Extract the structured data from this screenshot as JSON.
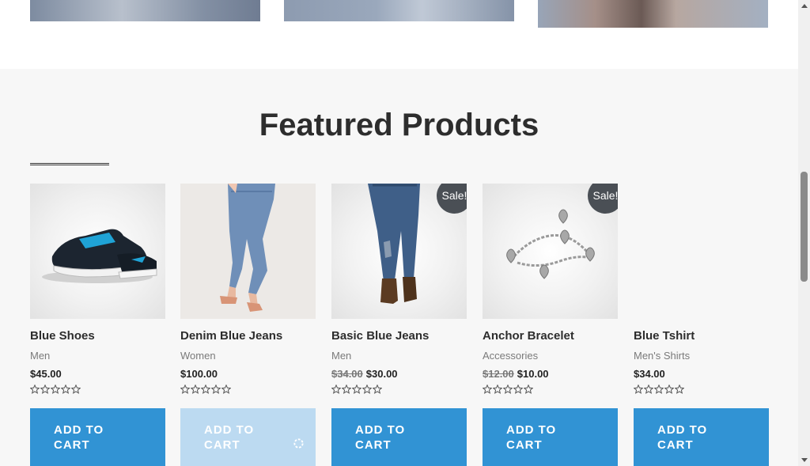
{
  "section_title": "Featured Products",
  "products": [
    {
      "name": "Blue Shoes",
      "category": "Men",
      "price": "$45.00",
      "old_price": "",
      "sale": "",
      "rating": 0,
      "button": "ADD TO CART",
      "image": "shoes-image"
    },
    {
      "name": "Denim Blue Jeans",
      "category": "Women",
      "price": "$100.00",
      "old_price": "",
      "sale": "",
      "rating": 0,
      "button": "ADD TO CART",
      "image": "jeans-image"
    },
    {
      "name": "Basic Blue Jeans",
      "category": "Men",
      "price": "$30.00",
      "old_price": "$34.00",
      "sale": "Sale!",
      "rating": 0,
      "button": "ADD TO CART",
      "image": "jeans-boots-image"
    },
    {
      "name": "Anchor Bracelet",
      "category": "Accessories",
      "price": "$10.00",
      "old_price": "$12.00",
      "sale": "Sale!",
      "rating": 0,
      "button": "ADD TO CART",
      "image": "bracelet-image"
    },
    {
      "name": "Blue Tshirt",
      "category": "Men's Shirts",
      "price": "$34.00",
      "old_price": "",
      "sale": "",
      "rating": 0,
      "button": "ADD TO CART",
      "image": ""
    }
  ],
  "colors": {
    "button": "#3193d4",
    "button_loading": "#bcdaf1",
    "badge": "#4a4f55",
    "section_bg": "#f7f7f7"
  }
}
